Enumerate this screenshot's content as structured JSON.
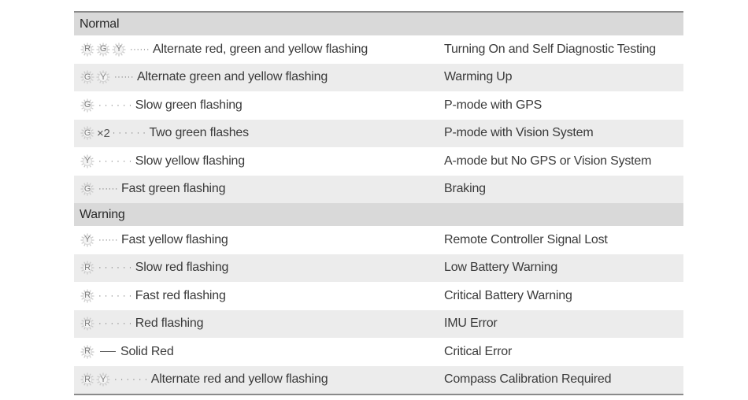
{
  "table": {
    "sections": [
      {
        "label": "Normal",
        "rows": [
          {
            "leds": [
              "R",
              "G",
              "Y"
            ],
            "suffix": "",
            "pattern": "dotted",
            "pattern_text": "······",
            "description": "Alternate red, green and yellow flashing",
            "meaning": "Turning On and Self Diagnostic Testing"
          },
          {
            "leds": [
              "G",
              "Y"
            ],
            "suffix": "",
            "pattern": "dotted",
            "pattern_text": "······",
            "description": "Alternate green and yellow flashing",
            "meaning": "Warming Up"
          },
          {
            "leds": [
              "G"
            ],
            "suffix": "",
            "pattern": "dotted",
            "pattern_text": "· · · · · ·",
            "description": "Slow green flashing",
            "meaning": "P-mode with GPS"
          },
          {
            "leds": [
              "G"
            ],
            "suffix": "×2",
            "pattern": "dotted",
            "pattern_text": "· · · · · ·",
            "description": "Two green flashes",
            "meaning": "P-mode with Vision System"
          },
          {
            "leds": [
              "Y"
            ],
            "suffix": "",
            "pattern": "dotted",
            "pattern_text": "· · · · · ·",
            "description": "Slow yellow flashing",
            "meaning": "A-mode but No GPS or Vision System"
          },
          {
            "leds": [
              "G"
            ],
            "suffix": "",
            "pattern": "dotted",
            "pattern_text": " ······",
            "description": "Fast green flashing",
            "meaning": "Braking"
          }
        ]
      },
      {
        "label": "Warning",
        "rows": [
          {
            "leds": [
              "Y"
            ],
            "suffix": "",
            "pattern": "dotted",
            "pattern_text": "······",
            "description": "Fast yellow flashing",
            "meaning": "Remote Controller Signal Lost"
          },
          {
            "leds": [
              "R"
            ],
            "suffix": "",
            "pattern": "dotted",
            "pattern_text": "· · · · · ·",
            "description": "Slow red flashing",
            "meaning": "Low Battery Warning"
          },
          {
            "leds": [
              "R"
            ],
            "suffix": "",
            "pattern": "dotted",
            "pattern_text": "· · · · · ·",
            "description": "Fast red flashing",
            "meaning": "Critical Battery Warning"
          },
          {
            "leds": [
              "R"
            ],
            "suffix": "",
            "pattern": "dotted",
            "pattern_text": "· · · · · ·",
            "description": "Red flashing",
            "meaning": "IMU Error"
          },
          {
            "leds": [
              "R"
            ],
            "suffix": "",
            "pattern": "solid",
            "pattern_text": "",
            "description": "Solid Red",
            "meaning": "Critical Error"
          },
          {
            "leds": [
              "R",
              "Y"
            ],
            "suffix": "",
            "pattern": "dotted",
            "pattern_text": "· · · · · ·",
            "description": "Alternate red and yellow flashing",
            "meaning": "Compass Calibration Required"
          }
        ]
      }
    ]
  },
  "icons": {
    "led": "sunburst-led-indicator-icon"
  },
  "colors": {
    "section_bg": "#d9d9d9",
    "shaded_row_bg": "#ececec",
    "border": "#8a8a8a",
    "text": "#3a3a3a"
  }
}
